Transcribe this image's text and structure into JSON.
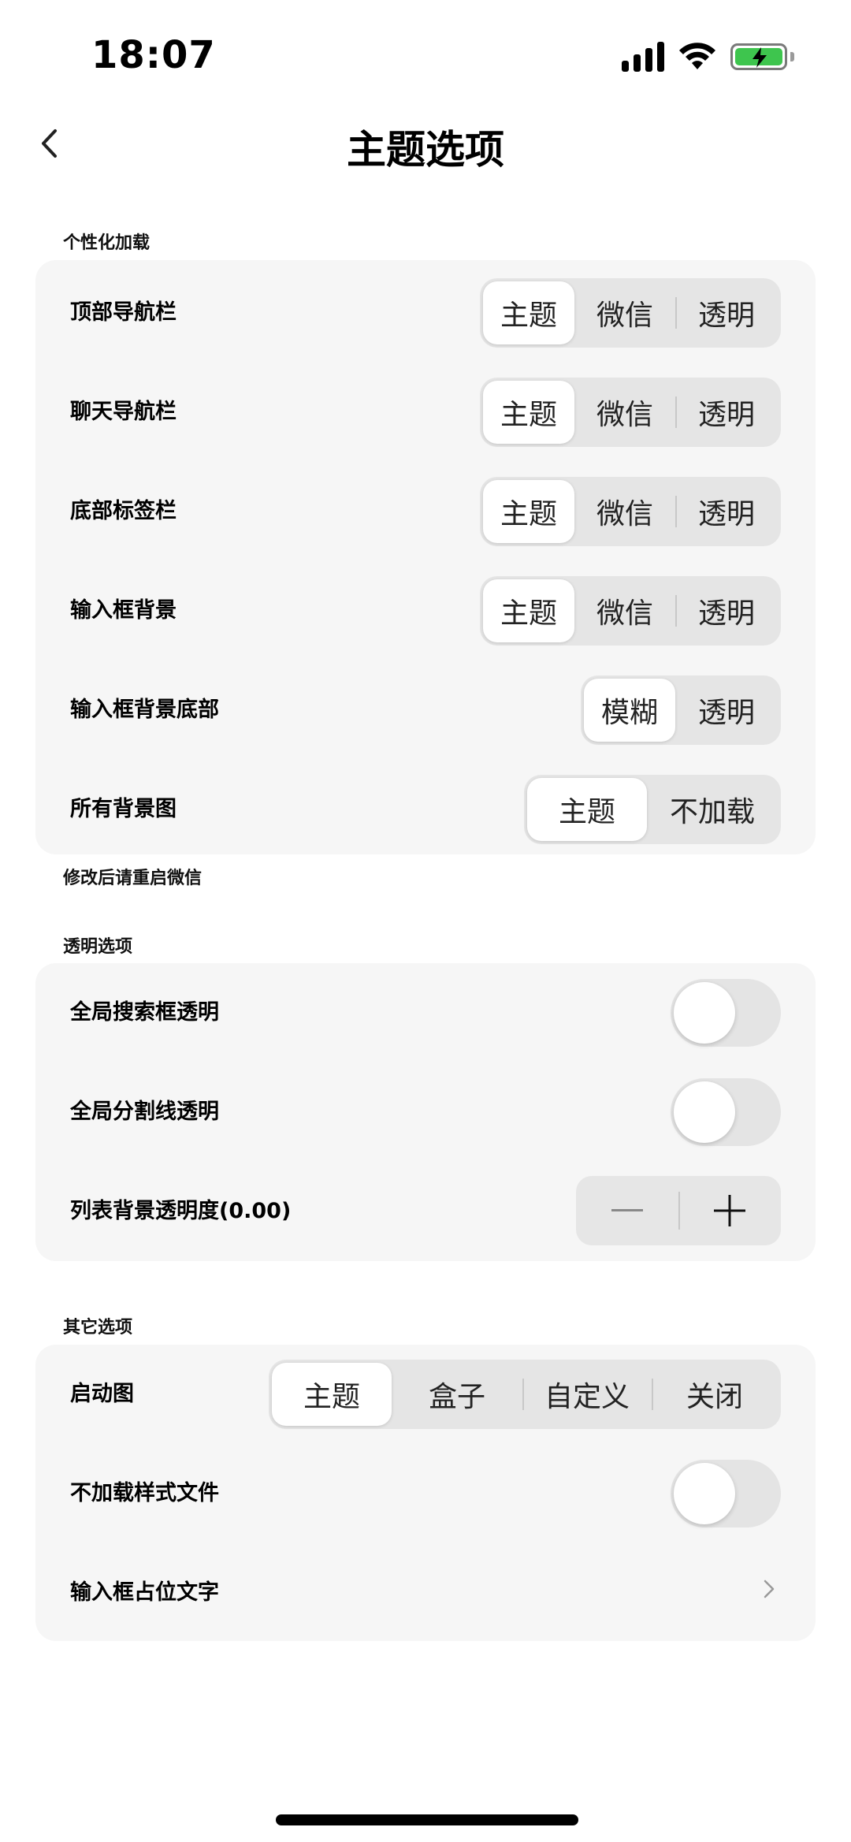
{
  "status_bar": {
    "time": "18:07"
  },
  "nav": {
    "title": "主题选项"
  },
  "sections": {
    "personalization": {
      "header": "个性化加载",
      "footer": "修改后请重启微信",
      "rows": [
        {
          "label": "顶部导航栏",
          "options": [
            "主题",
            "微信",
            "透明"
          ],
          "selected": "主题"
        },
        {
          "label": "聊天导航栏",
          "options": [
            "主题",
            "微信",
            "透明"
          ],
          "selected": "主题"
        },
        {
          "label": "底部标签栏",
          "options": [
            "主题",
            "微信",
            "透明"
          ],
          "selected": "主题"
        },
        {
          "label": "输入框背景",
          "options": [
            "主题",
            "微信",
            "透明"
          ],
          "selected": "主题"
        },
        {
          "label": "输入框背景底部",
          "options": [
            "模糊",
            "透明"
          ],
          "selected": "模糊"
        },
        {
          "label": "所有背景图",
          "options": [
            "主题",
            "不加载"
          ],
          "selected": "主题"
        }
      ]
    },
    "transparency": {
      "header": "透明选项",
      "rows": [
        {
          "label": "全局搜索框透明",
          "toggle": false
        },
        {
          "label": "全局分割线透明",
          "toggle": false
        },
        {
          "label": "列表背景透明度(0.00)"
        }
      ]
    },
    "other": {
      "header": "其它选项",
      "rows": [
        {
          "label": "启动图",
          "options": [
            "主题",
            "盒子",
            "自定义",
            "关闭"
          ],
          "selected": "主题"
        },
        {
          "label": "不加载样式文件",
          "toggle": false
        },
        {
          "label": "输入框占位文字"
        }
      ]
    }
  }
}
